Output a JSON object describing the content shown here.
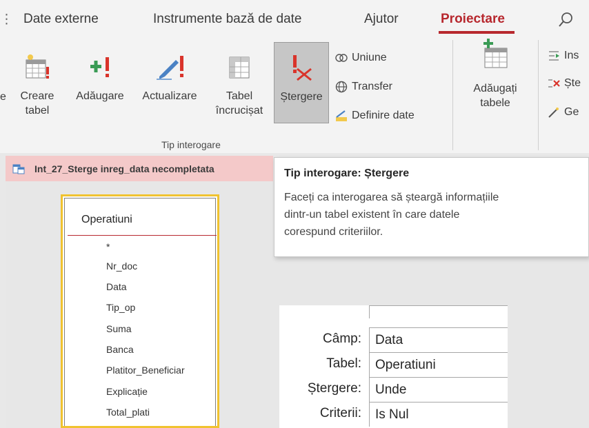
{
  "menu": {
    "tabs": [
      {
        "label": "Date externe"
      },
      {
        "label": "Instrumente bază de date"
      },
      {
        "label": "Ajutor"
      },
      {
        "label": "Proiectare"
      }
    ],
    "search_icon": "search-icon",
    "active_tab": "Proiectare"
  },
  "ribbon": {
    "clipped_left_char": "e",
    "creare_tabel": {
      "line1": "Creare",
      "line2": "tabel"
    },
    "adaugare": {
      "line1": "Adăugare"
    },
    "actualizare": {
      "line1": "Actualizare"
    },
    "tabel_incrucisat": {
      "line1": "Tabel",
      "line2": "încrucișat"
    },
    "stergere": {
      "line1": "Ștergere"
    },
    "uniune": "Uniune",
    "transfer": "Transfer",
    "definire_date": "Definire date",
    "adaugati_tabele": {
      "line1": "Adăugați",
      "line2": "tabele"
    },
    "insert_clipped": "Ins",
    "sterge_clipped": "Ște",
    "generator_clipped": "Ge",
    "group_label": "Tip interogare"
  },
  "query_tab": {
    "title": "Int_27_Sterge inreg_data necompletata"
  },
  "tooltip": {
    "title": "Tip interogare: Ștergere",
    "lines": [
      "Faceți ca interogarea să șteargă informațiile",
      "dintr-un tabel existent în care datele",
      "corespund criteriilor."
    ]
  },
  "table": {
    "name": "Operatiuni",
    "fields": [
      "*",
      "Nr_doc",
      "Data",
      "Tip_op",
      "Suma",
      "Banca",
      "Platitor_Beneficiar",
      "Explicație",
      "Total_plati"
    ]
  },
  "qbe": {
    "rows": [
      {
        "label": "Câmp:",
        "value": "Data"
      },
      {
        "label": "Tabel:",
        "value": "Operatiuni"
      },
      {
        "label": "Ștergere:",
        "value": "Unde"
      },
      {
        "label": "Criterii:",
        "value": "Is Nul"
      }
    ]
  },
  "colors": {
    "accent": "#b7282e",
    "ribbon_bg": "#f3f3f3",
    "selected_button": "#c6c6c6",
    "query_tab_bg": "#f4c9c9",
    "table_border": "#f0c330"
  }
}
